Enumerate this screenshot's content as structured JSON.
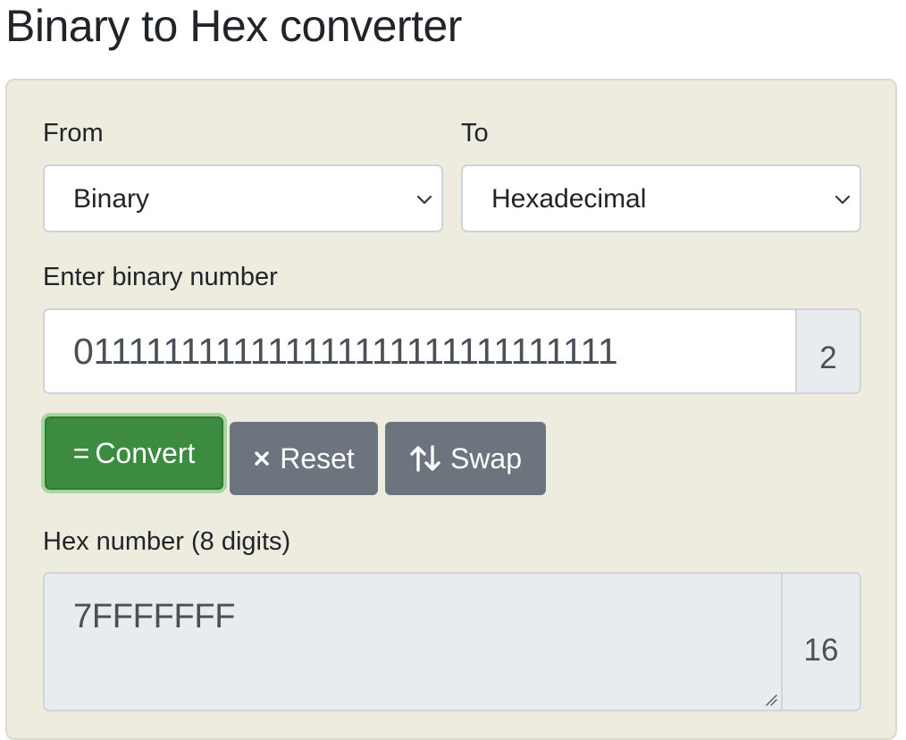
{
  "page": {
    "title": "Binary to Hex converter"
  },
  "form": {
    "from": {
      "label": "From",
      "selected": "Binary"
    },
    "to": {
      "label": "To",
      "selected": "Hexadecimal"
    },
    "input": {
      "label": "Enter binary number",
      "value": "0111111111111111111111111111111",
      "base": "2"
    },
    "buttons": {
      "convert_label": "Convert",
      "convert_symbol": "=",
      "reset_label": "Reset",
      "reset_symbol": "×",
      "swap_label": "Swap"
    },
    "output": {
      "label": "Hex number (8 digits)",
      "value": "7FFFFFFF",
      "base": "16"
    }
  },
  "colors": {
    "panel_background": "#eeecde",
    "convert_button": "#3d8b40",
    "secondary_button": "#6c757d",
    "readonly_background": "#e9ecef"
  },
  "icons": {
    "select_arrow": "chevron-down-icon",
    "reset": "x-icon",
    "swap": "swap-arrows-icon"
  }
}
